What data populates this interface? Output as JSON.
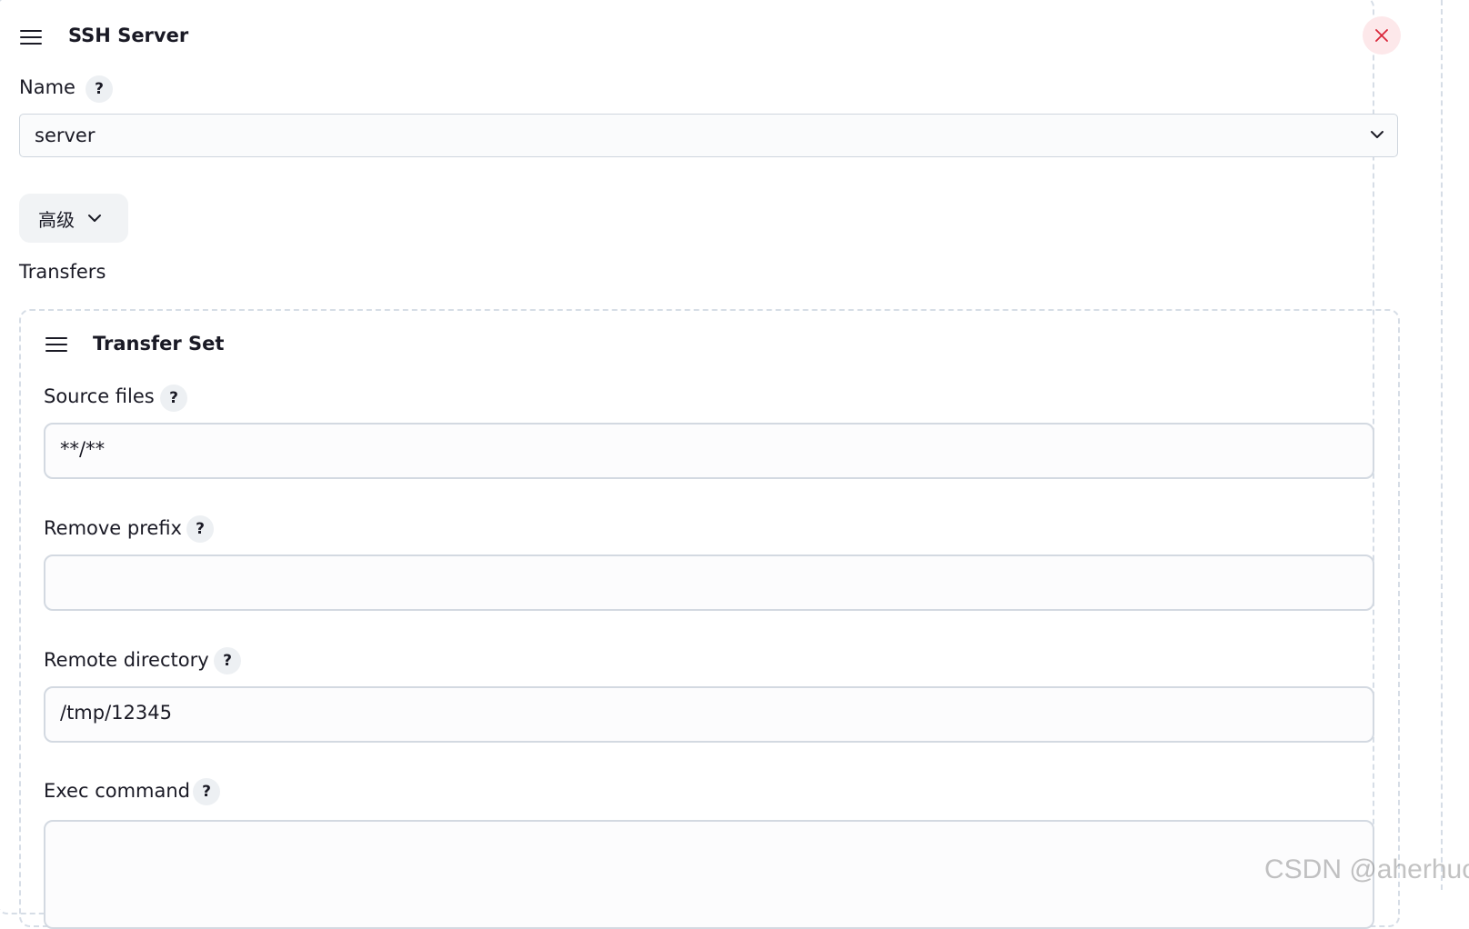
{
  "ssh_server": {
    "title": "SSH Server",
    "close_icon": "close-icon",
    "name_label": "Name",
    "name_help": "?",
    "name_value": "server",
    "advanced_label": "高级"
  },
  "transfers": {
    "label": "Transfers",
    "transfer_set": {
      "title": "Transfer Set",
      "source_files_label": "Source files",
      "source_files_value": "**/**",
      "remove_prefix_label": "Remove prefix",
      "remove_prefix_value": "",
      "remote_directory_label": "Remote directory",
      "remote_directory_value": "/tmp/12345",
      "exec_command_label": "Exec command",
      "exec_command_value": "",
      "help": "?"
    }
  },
  "watermark": "CSDN @aherhuo",
  "colors": {
    "close_icon": "#d9263a",
    "close_bg": "#fde8ea",
    "border": "#d3d9e1",
    "dashed": "#d6dde6",
    "text": "#1a1a25"
  }
}
